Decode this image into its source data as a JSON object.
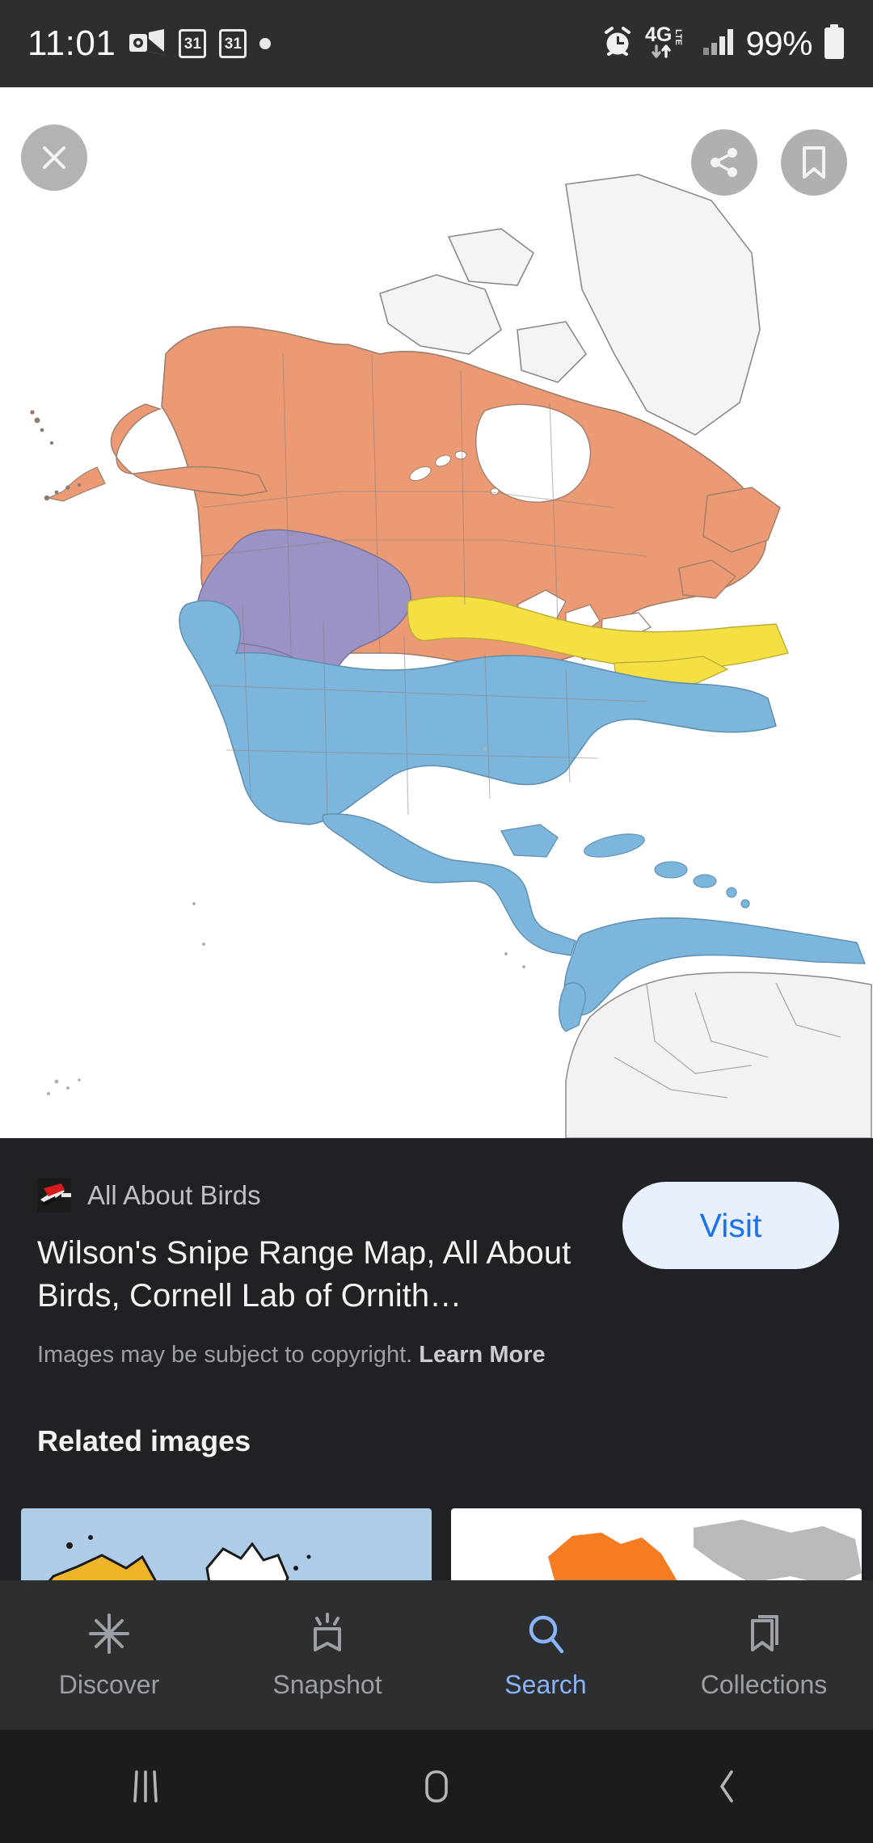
{
  "statusbar": {
    "time": "11:01",
    "battery_percent": "99%",
    "network": "4G",
    "network_sub": "LTE",
    "calendar_badge_1": "31",
    "calendar_badge_2": "31",
    "icons": [
      "outlook-icon",
      "calendar-icon",
      "calendar-icon",
      "dot-icon",
      "alarm-icon",
      "network-4glte-icon",
      "signal-icon",
      "battery-icon"
    ]
  },
  "viewer": {
    "close_label": "Close",
    "share_label": "Share",
    "save_label": "Save",
    "image_alt": "Wilson's Snipe range map of North America"
  },
  "map_legend": {
    "breeding": "#ea9a74",
    "year_round": "#9a93c4",
    "migration": "#f5e040",
    "wintering": "#7cb6dd",
    "no_range": "#f0f0f0",
    "outline": "#7a7a7a",
    "background": "#ffffff"
  },
  "detail": {
    "source": "All About Birds",
    "favicon": "bird-logo-icon",
    "title": "Wilson's Snipe Range Map, All About Birds, Cornell Lab of Ornith…",
    "copyright_text": "Images may be subject to copyright.",
    "learn_more": "Learn More",
    "visit_label": "Visit"
  },
  "related": {
    "heading": "Related images",
    "items": [
      {
        "name": "related-thumb-1",
        "bg": "#aecbe8",
        "land": "#f0b429"
      },
      {
        "name": "related-thumb-2",
        "bg": "#ffffff",
        "land": "#f57c20"
      }
    ]
  },
  "bottomnav": {
    "items": [
      {
        "label": "Discover",
        "icon": "discover-icon",
        "active": false
      },
      {
        "label": "Snapshot",
        "icon": "snapshot-icon",
        "active": false
      },
      {
        "label": "Search",
        "icon": "search-icon",
        "active": true
      },
      {
        "label": "Collections",
        "icon": "collections-icon",
        "active": false
      }
    ],
    "active_color": "#8ab4f8",
    "inactive_color": "#9aa0a6"
  },
  "androidnav": {
    "items": [
      {
        "label": "Recents",
        "icon": "recents-icon"
      },
      {
        "label": "Home",
        "icon": "home-icon"
      },
      {
        "label": "Back",
        "icon": "back-icon"
      }
    ]
  }
}
